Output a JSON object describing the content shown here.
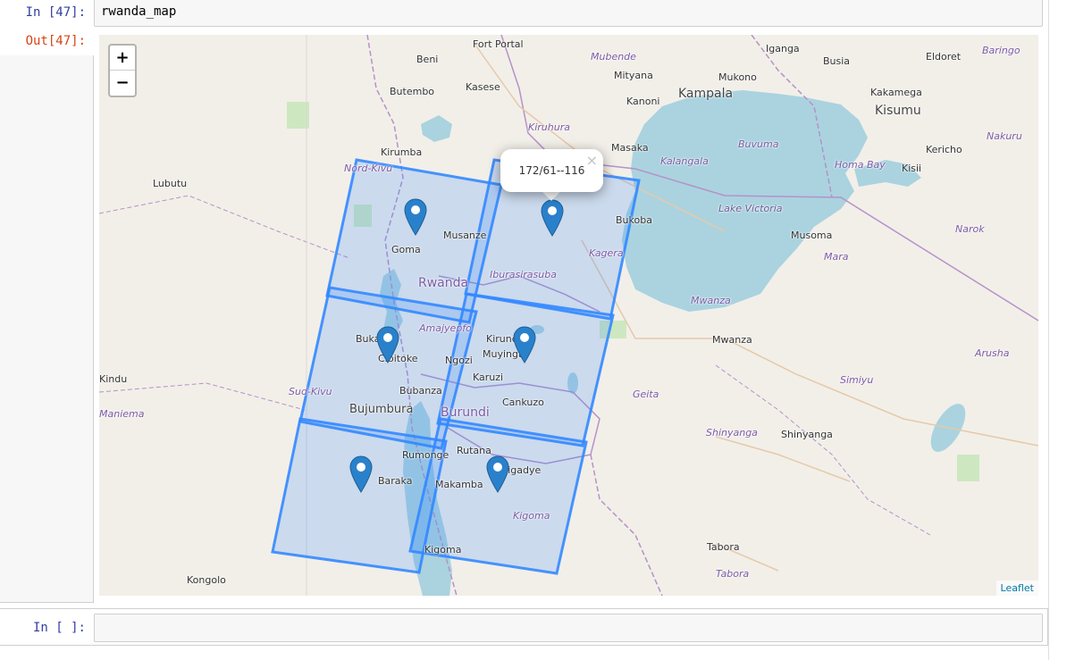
{
  "cells": {
    "input_prompt": "In [47]:",
    "input_code": "rwanda_map",
    "output_prompt": "Out[47]:",
    "empty_prompt": "In [ ]:"
  },
  "map": {
    "zoom_in": "+",
    "zoom_out": "−",
    "popup_text": "172/61--116",
    "popup_close": "×",
    "attribution": "Leaflet",
    "colors": {
      "footprint": "#3388ff",
      "water": "#aad3df",
      "land": "#f2efe9",
      "border": "#b592c8",
      "marker": "#2a81cb"
    },
    "places": {
      "fort_portal": "Fort Portal",
      "beni": "Beni",
      "mubende": "Mubende",
      "iganga": "Iganga",
      "busia": "Busia",
      "eldoret": "Eldoret",
      "baringo": "Baringo",
      "butembo": "Butembo",
      "kasese": "Kasese",
      "mityana": "Mityana",
      "mukono": "Mukono",
      "kampala": "Kampala",
      "kanoni": "Kanoni",
      "kakamega": "Kakamega",
      "kisumu": "Kisumu",
      "kiruhura": "Kiruhura",
      "kirumba": "Kirumba",
      "masaka": "Masaka",
      "buvuma": "Buvuma",
      "nakuru": "Nakuru",
      "kericho": "Kericho",
      "lubutu": "Lubutu",
      "nord_kivu": "Nord-Kivu",
      "kalangala": "Kalangala",
      "homa_bay": "Homa Bay",
      "kisii": "Kisii",
      "bukoba": "Bukoba",
      "lake_victoria": "Lake Victoria",
      "musanze": "Musanze",
      "goma": "Goma",
      "musoma": "Musoma",
      "narok": "Narok",
      "kagera": "Kagera",
      "mara": "Mara",
      "iburasirasuba": "Iburasirasuba",
      "rwanda": "Rwanda",
      "mwanza_region": "Mwanza",
      "amajyepfo": "Amajyepfo",
      "bukavu": "Bukavu",
      "kirundo": "Kirundo",
      "mwanza": "Mwanza",
      "arusha": "Arusha",
      "cyitoke": "Cibitoke",
      "ngozi": "Ngozi",
      "muyinga": "Muyinga",
      "kindu": "Kindu",
      "karuzi": "Karuzi",
      "sud_kivu": "Sud-Kivu",
      "geita": "Geita",
      "simiyu": "Simiyu",
      "bubanza": "Bubanza",
      "cankuzo": "Cankuzo",
      "bujumbura": "Bujumbura",
      "burundi": "Burundi",
      "maniema": "Maniema",
      "shinyanga_region": "Shinyanga",
      "shinyanga": "Shinyanga",
      "rumonge": "Rumonge",
      "rutana": "Rutana",
      "baraka": "Baraka",
      "makamba": "Makamba",
      "kibondo": "Kigadye",
      "kigoma_region": "Kigoma",
      "kigoma": "Kigoma",
      "tabora": "Tabora",
      "tabora_region": "Tabora",
      "kongolo": "Kongolo"
    }
  }
}
